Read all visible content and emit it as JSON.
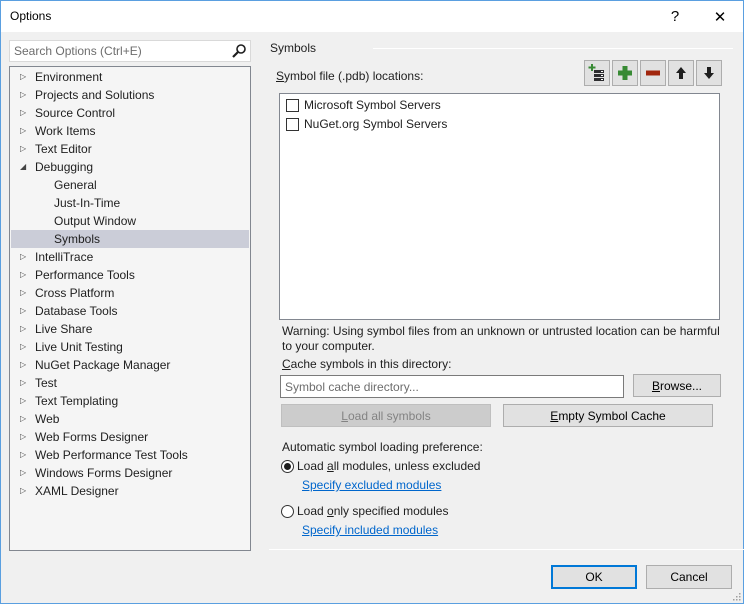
{
  "window": {
    "title": "Options",
    "help_glyph": "?",
    "close_glyph": "✕"
  },
  "search": {
    "placeholder": "Search Options (Ctrl+E)",
    "value": "",
    "icon": "search-icon"
  },
  "tree": {
    "items": [
      {
        "label": "Environment",
        "expandable": true,
        "expanded": false,
        "level": 0
      },
      {
        "label": "Projects and Solutions",
        "expandable": true,
        "expanded": false,
        "level": 0
      },
      {
        "label": "Source Control",
        "expandable": true,
        "expanded": false,
        "level": 0
      },
      {
        "label": "Work Items",
        "expandable": true,
        "expanded": false,
        "level": 0
      },
      {
        "label": "Text Editor",
        "expandable": true,
        "expanded": false,
        "level": 0
      },
      {
        "label": "Debugging",
        "expandable": true,
        "expanded": true,
        "level": 0
      },
      {
        "label": "General",
        "expandable": false,
        "level": 1
      },
      {
        "label": "Just-In-Time",
        "expandable": false,
        "level": 1
      },
      {
        "label": "Output Window",
        "expandable": false,
        "level": 1
      },
      {
        "label": "Symbols",
        "expandable": false,
        "level": 1,
        "selected": true
      },
      {
        "label": "IntelliTrace",
        "expandable": true,
        "expanded": false,
        "level": 0
      },
      {
        "label": "Performance Tools",
        "expandable": true,
        "expanded": false,
        "level": 0
      },
      {
        "label": "Cross Platform",
        "expandable": true,
        "expanded": false,
        "level": 0
      },
      {
        "label": "Database Tools",
        "expandable": true,
        "expanded": false,
        "level": 0
      },
      {
        "label": "Live Share",
        "expandable": true,
        "expanded": false,
        "level": 0
      },
      {
        "label": "Live Unit Testing",
        "expandable": true,
        "expanded": false,
        "level": 0
      },
      {
        "label": "NuGet Package Manager",
        "expandable": true,
        "expanded": false,
        "level": 0
      },
      {
        "label": "Test",
        "expandable": true,
        "expanded": false,
        "level": 0
      },
      {
        "label": "Text Templating",
        "expandable": true,
        "expanded": false,
        "level": 0
      },
      {
        "label": "Web",
        "expandable": true,
        "expanded": false,
        "level": 0
      },
      {
        "label": "Web Forms Designer",
        "expandable": true,
        "expanded": false,
        "level": 0
      },
      {
        "label": "Web Performance Test Tools",
        "expandable": true,
        "expanded": false,
        "level": 0
      },
      {
        "label": "Windows Forms Designer",
        "expandable": true,
        "expanded": false,
        "level": 0
      },
      {
        "label": "XAML Designer",
        "expandable": true,
        "expanded": false,
        "level": 0
      }
    ],
    "collapsed_glyph": "▷",
    "expanded_glyph": "◢"
  },
  "symbols": {
    "section_title": "Symbols",
    "pdb_label_mnemonic": "S",
    "pdb_label_rest": "ymbol file (.pdb) locations:",
    "toolbar": [
      {
        "name": "add-symbol-server-button",
        "icon": "add-server-icon",
        "tooltip": ""
      },
      {
        "name": "add-location-button",
        "icon": "plus-icon"
      },
      {
        "name": "remove-location-button",
        "icon": "minus-icon"
      },
      {
        "name": "move-up-button",
        "icon": "arrow-up-icon"
      },
      {
        "name": "move-down-button",
        "icon": "arrow-down-icon"
      }
    ],
    "locations": [
      {
        "label": "Microsoft Symbol Servers",
        "checked": false
      },
      {
        "label": "NuGet.org Symbol Servers",
        "checked": false
      }
    ],
    "warning": "Warning: Using symbol files from an unknown or untrusted location can be harmful to your computer.",
    "cache_label_mnemonic": "C",
    "cache_label_rest": "ache symbols in this directory:",
    "cache_input": {
      "placeholder": "Symbol cache directory...",
      "value": ""
    },
    "browse": {
      "mnemonic": "B",
      "rest": "rowse..."
    },
    "load_all": {
      "mnemonic": "L",
      "rest": "oad all symbols",
      "enabled": false
    },
    "empty_cache": {
      "mnemonic": "E",
      "rest": "mpty Symbol Cache"
    },
    "auto_label": "Automatic symbol loading preference:",
    "options": [
      {
        "pre": "Load ",
        "mnemonic": "a",
        "post": "ll modules, unless excluded",
        "checked": true,
        "link": "Specify excluded modules"
      },
      {
        "pre": "Load ",
        "mnemonic": "o",
        "post": "nly specified modules",
        "checked": false,
        "link": "Specify included modules"
      }
    ]
  },
  "footer": {
    "ok": "OK",
    "cancel": "Cancel"
  },
  "colors": {
    "accent": "#0078d7",
    "selection": "#cbcdd8",
    "link": "#0066cc",
    "add_green": "#388a34",
    "remove_red": "#a1260d"
  }
}
